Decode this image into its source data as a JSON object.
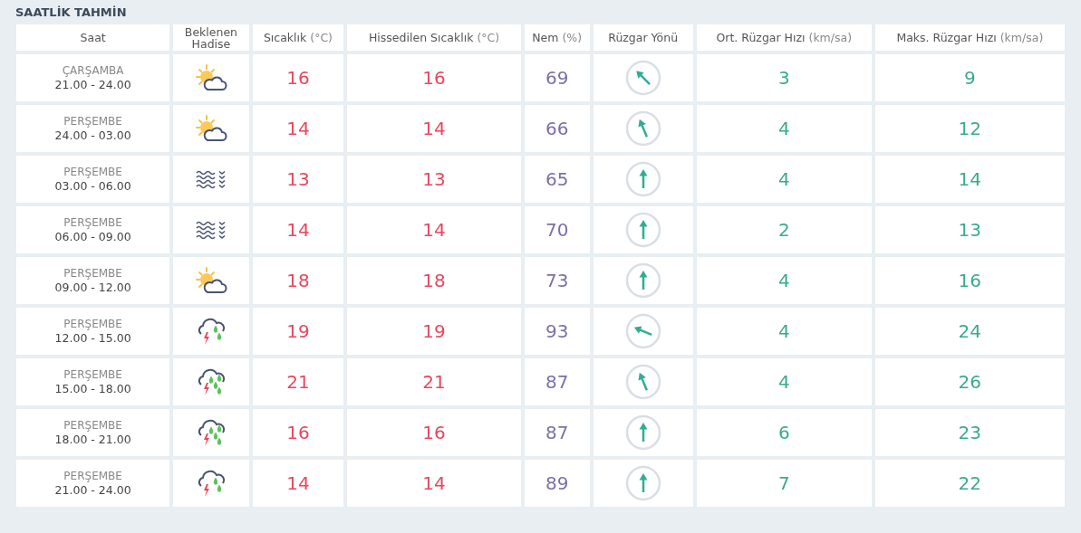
{
  "title": "SAATLİK TAHMİN",
  "columns": [
    {
      "label": "Saat"
    },
    {
      "label": "Beklenen Hadise"
    },
    {
      "label": "Sıcaklık",
      "unit": "(°C)"
    },
    {
      "label": "Hissedilen Sıcaklık",
      "unit": "(°C)"
    },
    {
      "label": "Nem",
      "unit": "(%)"
    },
    {
      "label": "Rüzgar Yönü"
    },
    {
      "label": "Ort. Rüzgar Hızı",
      "unit": "(km/sa)"
    },
    {
      "label": "Maks. Rüzgar Hızı",
      "unit": "(km/sa)"
    }
  ],
  "rows": [
    {
      "day": "ÇARŞAMBA",
      "time": "21.00 - 24.00",
      "weather": {
        "kind": "partly_cloudy"
      },
      "temp": "16",
      "feels": "16",
      "humidity": "69",
      "wind": {
        "kind": "nw"
      },
      "wind_avg": "3",
      "wind_max": "9"
    },
    {
      "day": "PERŞEMBE",
      "time": "24.00 - 03.00",
      "weather": {
        "kind": "partly_cloudy"
      },
      "temp": "14",
      "feels": "14",
      "humidity": "66",
      "wind": {
        "kind": "nnw"
      },
      "wind_avg": "4",
      "wind_max": "12"
    },
    {
      "day": "PERŞEMBE",
      "time": "03.00 - 06.00",
      "weather": {
        "kind": "fog"
      },
      "temp": "13",
      "feels": "13",
      "humidity": "65",
      "wind": {
        "kind": "n"
      },
      "wind_avg": "4",
      "wind_max": "14"
    },
    {
      "day": "PERŞEMBE",
      "time": "06.00 - 09.00",
      "weather": {
        "kind": "fog"
      },
      "temp": "14",
      "feels": "14",
      "humidity": "70",
      "wind": {
        "kind": "n"
      },
      "wind_avg": "2",
      "wind_max": "13"
    },
    {
      "day": "PERŞEMBE",
      "time": "09.00 - 12.00",
      "weather": {
        "kind": "partly_cloudy"
      },
      "temp": "18",
      "feels": "18",
      "humidity": "73",
      "wind": {
        "kind": "n"
      },
      "wind_avg": "4",
      "wind_max": "16"
    },
    {
      "day": "PERŞEMBE",
      "time": "12.00 - 15.00",
      "weather": {
        "kind": "thunderstorm"
      },
      "temp": "19",
      "feels": "19",
      "humidity": "93",
      "wind": {
        "kind": "wnw"
      },
      "wind_avg": "4",
      "wind_max": "24"
    },
    {
      "day": "PERŞEMBE",
      "time": "15.00 - 18.00",
      "weather": {
        "kind": "heavy_thunderstorm"
      },
      "temp": "21",
      "feels": "21",
      "humidity": "87",
      "wind": {
        "kind": "nnw"
      },
      "wind_avg": "4",
      "wind_max": "26"
    },
    {
      "day": "PERŞEMBE",
      "time": "18.00 - 21.00",
      "weather": {
        "kind": "heavy_thunderstorm"
      },
      "temp": "16",
      "feels": "16",
      "humidity": "87",
      "wind": {
        "kind": "n"
      },
      "wind_avg": "6",
      "wind_max": "23"
    },
    {
      "day": "PERŞEMBE",
      "time": "21.00 - 24.00",
      "weather": {
        "kind": "thunderstorm"
      },
      "temp": "14",
      "feels": "14",
      "humidity": "89",
      "wind": {
        "kind": "n"
      },
      "wind_avg": "7",
      "wind_max": "22"
    }
  ]
}
